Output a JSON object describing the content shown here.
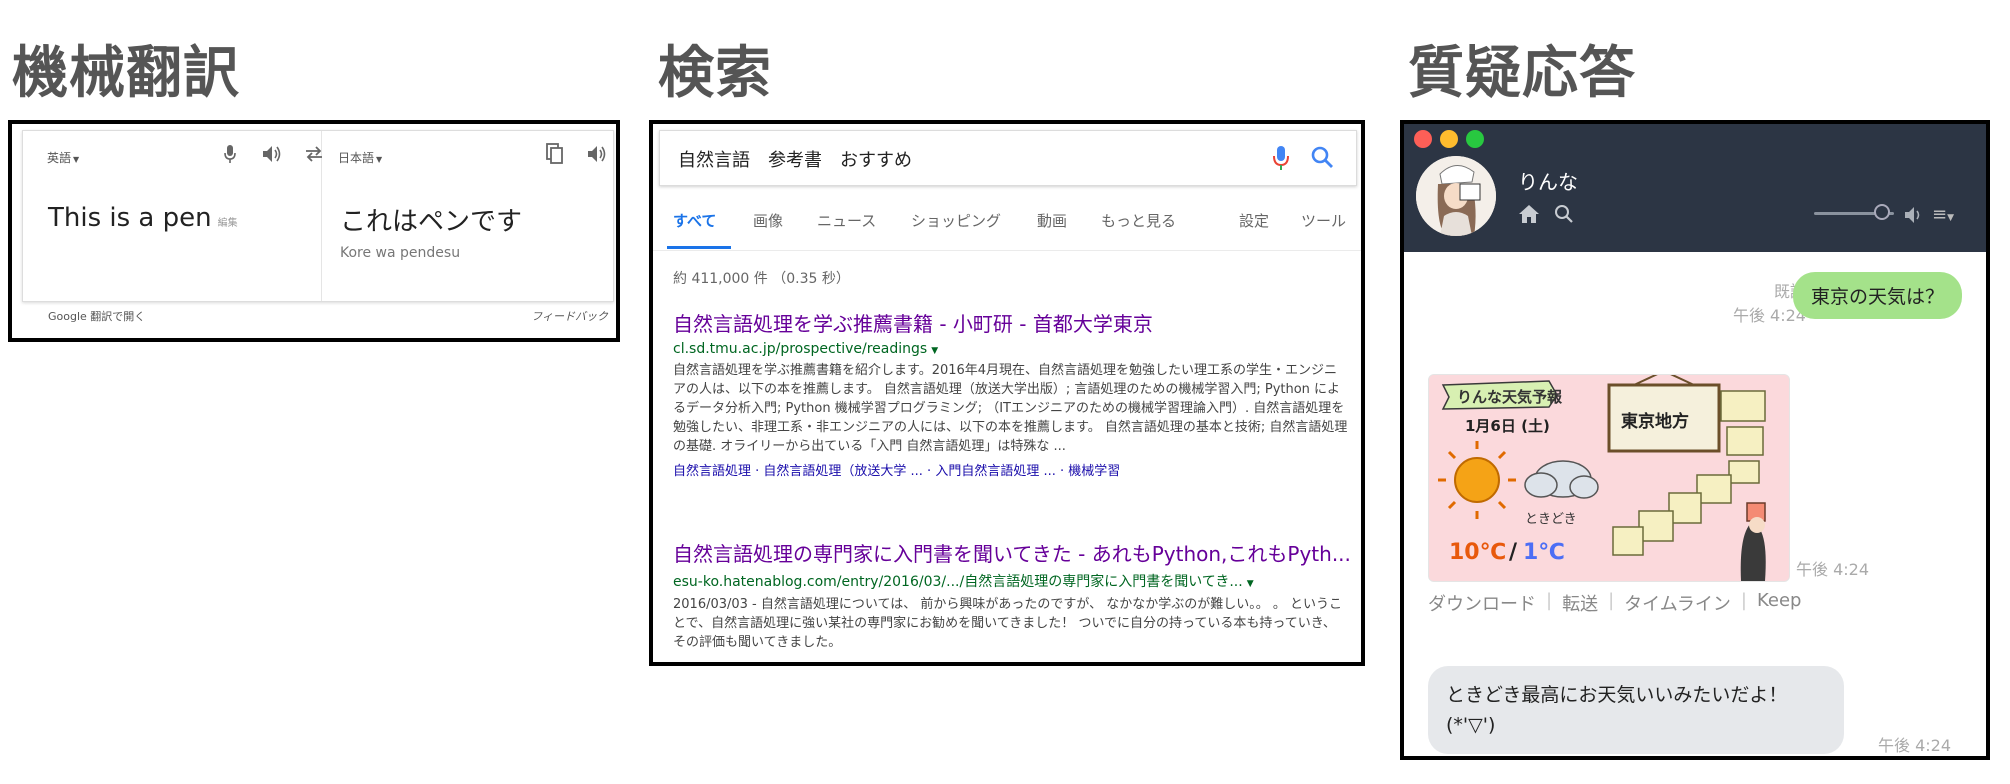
{
  "sections": {
    "translate_title": "機械翻訳",
    "search_title": "検索",
    "qa_title": "質疑応答"
  },
  "translate": {
    "source_lang": "英語",
    "target_lang": "日本語",
    "source_text": "This is a pen",
    "edit_label": "編集",
    "target_text": "これはペンです",
    "romanization": "Kore wa pendesu",
    "open_in_google": "Google 翻訳で開く",
    "feedback": "フィードバック"
  },
  "search": {
    "query": "自然言語　参考書　おすすめ",
    "tabs": [
      {
        "label": "すべて"
      },
      {
        "label": "画像"
      },
      {
        "label": "ニュース"
      },
      {
        "label": "ショッピング"
      },
      {
        "label": "動画"
      },
      {
        "label": "もっと見る"
      },
      {
        "label": "設定"
      },
      {
        "label": "ツール"
      }
    ],
    "stats": "約 411,000 件 （0.35 秒）",
    "results": [
      {
        "title": "自然言語処理を学ぶ推薦書籍 - 小町研 - 首都大学東京",
        "url": "cl.sd.tmu.ac.jp/prospective/readings",
        "snippet": "自然言語処理を学ぶ推薦書籍を紹介します。2016年4月現在、自然言語処理を勉強したい理工系の学生・エンジニアの人は、以下の本を推薦します。 自然言語処理（放送大学出版）; 言語処理のための機械学習入門; Python によるデータ分析入門; Python 機械学習プログラミング; （ITエンジニアのための機械学習理論入門）. 自然言語処理を勉強したい、非理工系・非エンジニアの人には、以下の本を推薦します。 自然言語処理の基本と技術; 自然言語処理の基礎. オライリーから出ている「入門 自然言語処理」は特殊な ...",
        "sublinks": "自然言語処理 · 自然言語処理（放送大学 ... · 入門自然言語処理 ... · 機械学習"
      },
      {
        "title": "自然言語処理の専門家に入門書を聞いてきた - あれもPython,これもPyth...",
        "url": "esu-ko.hatenablog.com/entry/2016/03/.../自然言語処理の専門家に入門書を聞いてき...",
        "snippet": "2016/03/03 - 自然言語処理については、 前から興味があったのですが、 なかなか学ぶのが難しい。。 。 ということで、自然言語処理に強い某社の専門家にお勧めを聞いてきました！ ついでに自分の持っている本も持っていき、 その評価も聞いてきました。"
      }
    ]
  },
  "qa": {
    "contact_name": "りんな",
    "user_message": "東京の天気は？",
    "read_label": "既読",
    "time1": "午後 4:24",
    "image": {
      "banner": "りんな天気予報",
      "date": "1月6日 (土)",
      "region": "東京地方",
      "sometimes": "ときどき",
      "high": "10℃",
      "low": "1℃"
    },
    "time2": "午後 4:24",
    "actions": [
      "ダウンロード",
      "転送",
      "タイムライン",
      "Keep"
    ],
    "bot_message": "ときどき最高にお天気いいみたいだよ！(*'▽')",
    "time3": "午後 4:24"
  }
}
